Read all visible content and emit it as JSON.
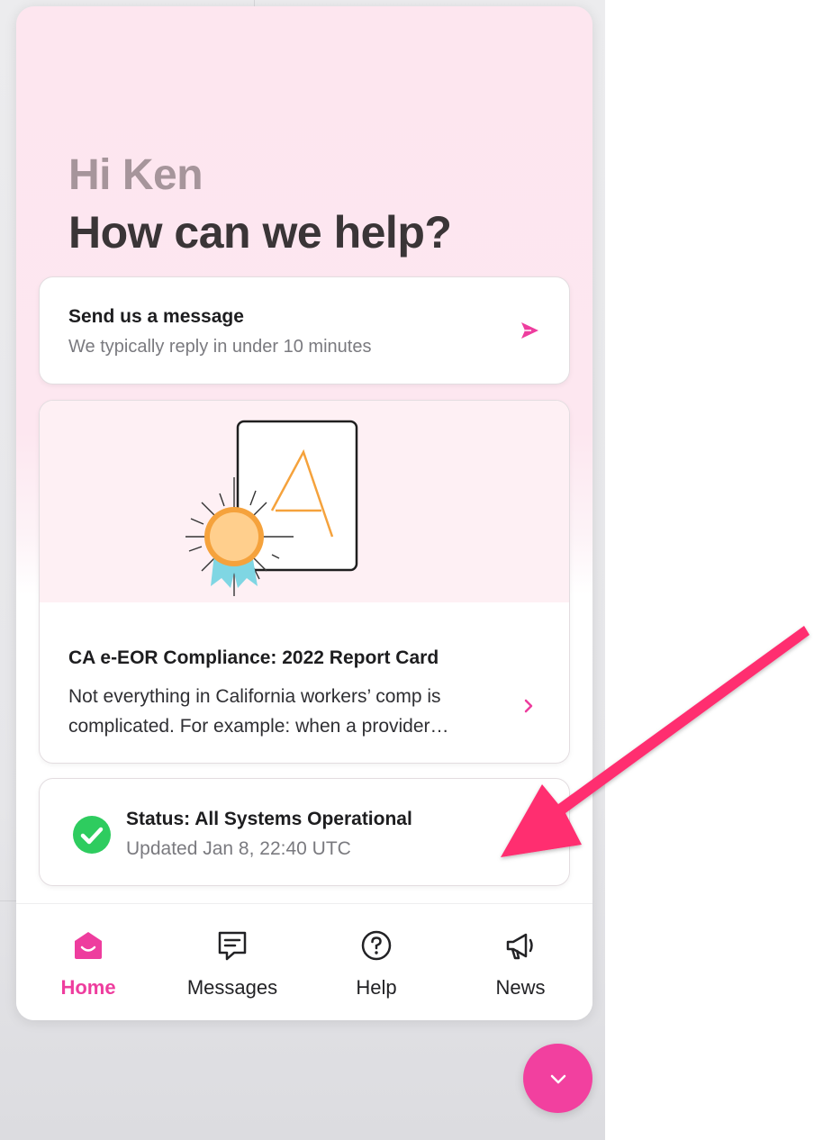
{
  "home": {
    "greeting": "Hi Ken",
    "headline": "How can we help?"
  },
  "message_card": {
    "title": "Send us a message",
    "subtitle": "We typically reply in under 10 minutes",
    "icon": "send-icon"
  },
  "article_card": {
    "title": "CA e-EOR Compliance: 2022 Report Card",
    "body": "Not everything in California workers’ comp is complicated. For example: when a provider receives an electronic Explanation of Review...",
    "illustration_letter": "A",
    "icon": "chevron-right-icon"
  },
  "status_card": {
    "title": "Status: All Systems Operational",
    "updated": "Updated Jan 8, 22:40 UTC",
    "icon": "check-circle-icon",
    "status_color": "#2ecc5f"
  },
  "nav": {
    "items": [
      {
        "label": "Home",
        "icon": "home-icon",
        "active": true
      },
      {
        "label": "Messages",
        "icon": "messages-icon",
        "active": false
      },
      {
        "label": "Help",
        "icon": "help-icon",
        "active": false
      },
      {
        "label": "News",
        "icon": "megaphone-icon",
        "active": false
      }
    ]
  },
  "launcher": {
    "icon": "chevron-down-icon"
  },
  "colors": {
    "accent": "#ee3d9e",
    "annotation_arrow": "#ff2d6f"
  }
}
